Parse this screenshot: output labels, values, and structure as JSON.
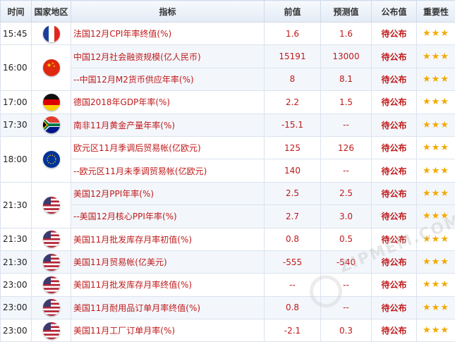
{
  "headers": {
    "time": "时间",
    "region": "国家地区",
    "indicator": "指标",
    "prev": "前值",
    "forecast": "预测值",
    "published": "公布值",
    "importance": "重要性"
  },
  "rows": [
    {
      "time": "15:45",
      "flag": "france-flag-icon",
      "indicator": "法国12月CPI年率终值(%)",
      "prev": "1.6",
      "forecast": "1.6",
      "published": "待公布",
      "stars": "★★★"
    },
    {
      "time": "16:00",
      "flag": "china-flag-icon",
      "indicator": "中国12月社会融资规模(亿人民币)",
      "prev": "15191",
      "forecast": "13000",
      "published": "待公布",
      "stars": "★★★"
    },
    {
      "time": "",
      "flag": "",
      "indicator": "--中国12月M2货币供应年率(%)",
      "prev": "8",
      "forecast": "8.1",
      "published": "待公布",
      "stars": "★★★"
    },
    {
      "time": "17:00",
      "flag": "germany-flag-icon",
      "indicator": "德国2018年GDP年率(%)",
      "prev": "2.2",
      "forecast": "1.5",
      "published": "待公布",
      "stars": "★★★"
    },
    {
      "time": "17:30",
      "flag": "south-africa-flag-icon",
      "indicator": "南非11月黄金产量年率(%)",
      "prev": "-15.1",
      "forecast": "--",
      "published": "待公布",
      "stars": "★★★"
    },
    {
      "time": "18:00",
      "flag": "eu-flag-icon",
      "indicator": "欧元区11月季调后贸易帐(亿欧元)",
      "prev": "125",
      "forecast": "126",
      "published": "待公布",
      "stars": "★★★"
    },
    {
      "time": "",
      "flag": "",
      "indicator": "--欧元区11月未季调贸易帐(亿欧元)",
      "prev": "140",
      "forecast": "--",
      "published": "待公布",
      "stars": "★★★"
    },
    {
      "time": "21:30",
      "flag": "usa-flag-icon",
      "indicator": "美国12月PPI年率(%)",
      "prev": "2.5",
      "forecast": "2.5",
      "published": "待公布",
      "stars": "★★★"
    },
    {
      "time": "",
      "flag": "",
      "indicator": "--美国12月核心PPI年率(%)",
      "prev": "2.7",
      "forecast": "3.0",
      "published": "待公布",
      "stars": "★★★"
    },
    {
      "time": "21:30",
      "flag": "usa-flag-icon",
      "indicator": "美国11月批发库存月率初值(%)",
      "prev": "0.8",
      "forecast": "0.5",
      "published": "待公布",
      "stars": "★★★"
    },
    {
      "time": "21:30",
      "flag": "usa-flag-icon",
      "indicator": "美国11月贸易帐(亿美元)",
      "prev": "-555",
      "forecast": "-540",
      "published": "待公布",
      "stars": "★★★"
    },
    {
      "time": "23:00",
      "flag": "usa-flag-icon",
      "indicator": "美国11月批发库存月率终值(%)",
      "prev": "--",
      "forecast": "--",
      "published": "待公布",
      "stars": "★★★"
    },
    {
      "time": "23:00",
      "flag": "usa-flag-icon",
      "indicator": "美国11月耐用品订单月率终值(%)",
      "prev": "0.8",
      "forecast": "--",
      "published": "待公布",
      "stars": "★★★"
    },
    {
      "time": "23:00",
      "flag": "usa-flag-icon",
      "indicator": "美国11月工厂订单月率(%)",
      "prev": "-2.1",
      "forecast": "0.3",
      "published": "待公布",
      "stars": "★★★"
    }
  ],
  "watermark": "ZIPMEM.COM",
  "colors": {
    "accent_red": "#c0191a",
    "star": "#f4a900",
    "header_bg": "#e3ebf6",
    "alt_row": "#f3f7fc"
  }
}
